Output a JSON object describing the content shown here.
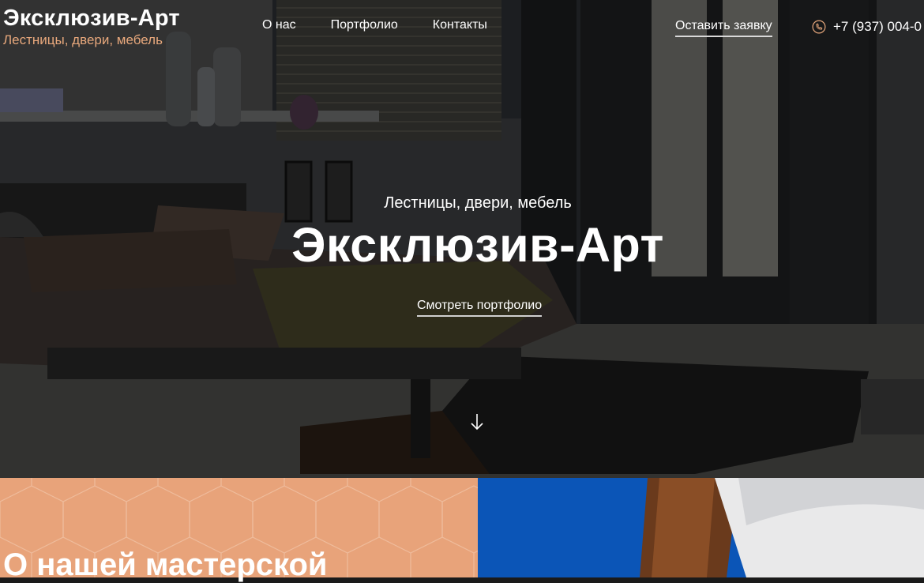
{
  "header": {
    "logo_title": "Эксклюзив-Арт",
    "logo_tagline": "Лестницы, двери, мебель",
    "nav": [
      "О нас",
      "Портфолио",
      "Контакты"
    ],
    "cta_label": "Оставить заявку",
    "phone": "+7 (937) 004-0",
    "phone_icon": "phone-icon"
  },
  "hero": {
    "subtitle": "Лестницы, двери, мебель",
    "title": "Эксклюзив-Арт",
    "button_label": "Смотреть портфолио",
    "scroll_icon": "arrow-down-icon"
  },
  "about": {
    "heading": "О нашей мастерской"
  },
  "colors": {
    "accent": "#e8a37a",
    "logo_tagline": "#e8a87c",
    "sky": "#0b55b7"
  }
}
